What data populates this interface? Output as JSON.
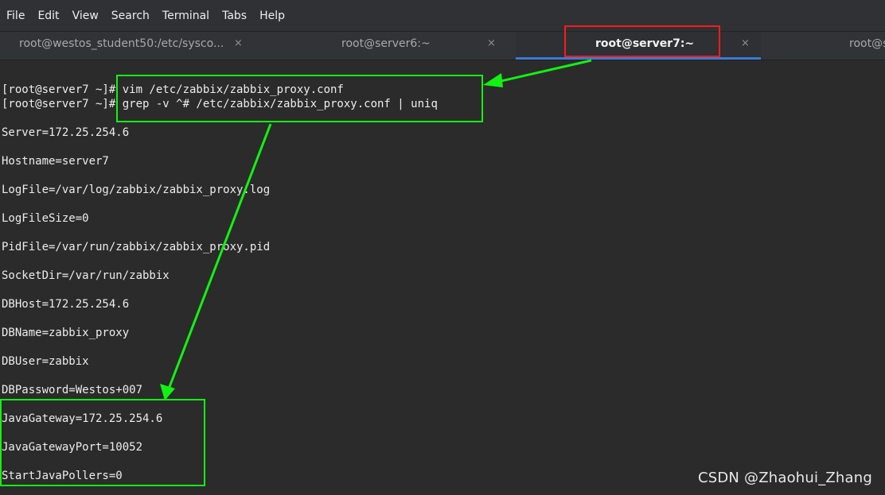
{
  "menu": {
    "items": [
      "File",
      "Edit",
      "View",
      "Search",
      "Terminal",
      "Tabs",
      "Help"
    ]
  },
  "tabs": [
    {
      "label": "root@westos_student50:/etc/sysco...",
      "close": "×",
      "active": false
    },
    {
      "label": "root@server6:~",
      "close": "×",
      "active": false
    },
    {
      "label": "root@server7:~",
      "close": "×",
      "active": true
    },
    {
      "label": "root@s",
      "close": "",
      "active": false
    }
  ],
  "terminal": {
    "lines": [
      "[root@server7 ~]# vim /etc/zabbix/zabbix_proxy.conf",
      "[root@server7 ~]# grep -v ^# /etc/zabbix/zabbix_proxy.conf | uniq",
      "Server=172.25.254.6",
      "Hostname=server7",
      "LogFile=/var/log/zabbix/zabbix_proxy.log",
      "LogFileSize=0",
      "PidFile=/var/run/zabbix/zabbix_proxy.pid",
      "SocketDir=/var/run/zabbix",
      "DBHost=172.25.254.6",
      "DBName=zabbix_proxy",
      "DBUser=zabbix",
      "DBPassword=Westos+007",
      "JavaGateway=172.25.254.6",
      "JavaGatewayPort=10052",
      "StartJavaPollers=0"
    ]
  },
  "watermark": "CSDN @Zhaohui_Zhang",
  "colors": {
    "annotation_green": "#12f212",
    "annotation_red": "#ff1a1a",
    "active_tab_underline": "#3a7bd5",
    "terminal_bg": "#2b2b2b"
  }
}
